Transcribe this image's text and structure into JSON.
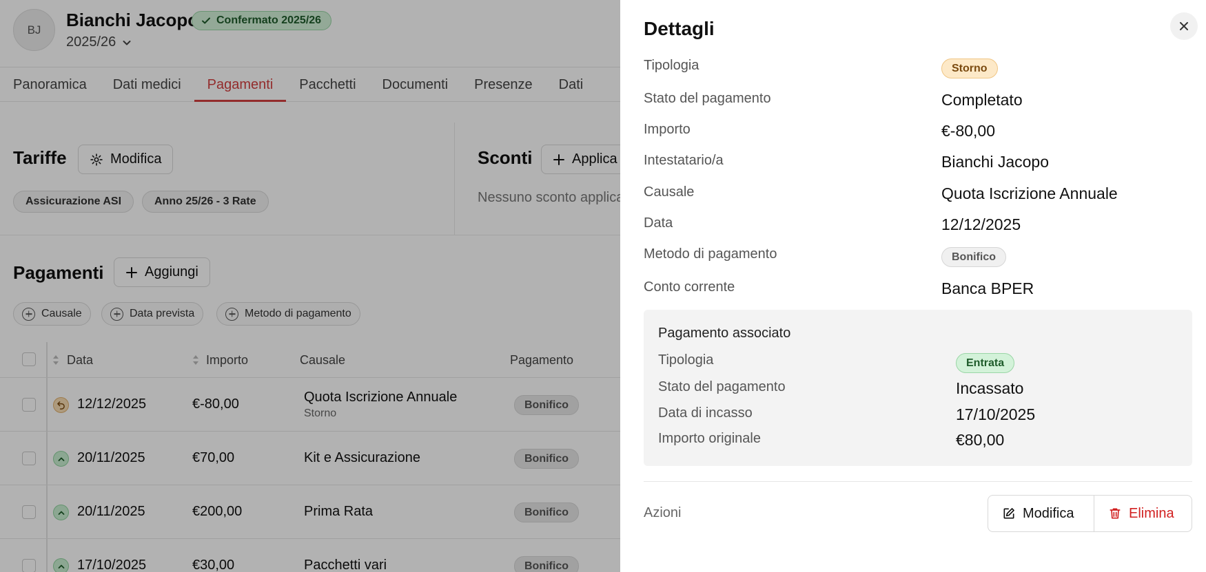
{
  "header": {
    "initials": "BJ",
    "name": "Bianchi Jacopo",
    "badge": "Confermato 2025/26",
    "year": "2025/26"
  },
  "tabs": [
    "Panoramica",
    "Dati medici",
    "Pagamenti",
    "Pacchetti",
    "Documenti",
    "Presenze",
    "Dati"
  ],
  "active_tab": "Pagamenti",
  "tariffe": {
    "title": "Tariffe",
    "edit_label": "Modifica",
    "pills": [
      "Assicurazione ASI",
      "Anno 25/26 - 3 Rate"
    ]
  },
  "sconti": {
    "title": "Sconti",
    "apply_label": "Applica",
    "empty": "Nessuno sconto applica"
  },
  "pagamenti": {
    "title": "Pagamenti",
    "add_label": "Aggiungi",
    "filters": [
      "Causale",
      "Data prevista",
      "Metodo di pagamento"
    ],
    "columns": [
      "Data",
      "Importo",
      "Causale",
      "Pagamento"
    ],
    "rows": [
      {
        "status": "storno",
        "date": "12/12/2025",
        "amount": "€-80,00",
        "causale": "Quota Iscrizione Annuale",
        "sub": "Storno",
        "method": "Bonifico"
      },
      {
        "status": "entrata",
        "date": "20/11/2025",
        "amount": "€70,00",
        "causale": "Kit e Assicurazione",
        "sub": "",
        "method": "Bonifico"
      },
      {
        "status": "entrata",
        "date": "20/11/2025",
        "amount": "€200,00",
        "causale": "Prima Rata",
        "sub": "",
        "method": "Bonifico"
      },
      {
        "status": "entrata",
        "date": "17/10/2025",
        "amount": "€30,00",
        "causale": "Pacchetti vari",
        "sub": "",
        "method": "Bonifico"
      }
    ]
  },
  "panel": {
    "title": "Dettagli",
    "fields": {
      "tipologia_label": "Tipologia",
      "tipologia_value": "Storno",
      "stato_label": "Stato del pagamento",
      "stato_value": "Completato",
      "importo_label": "Importo",
      "importo_value": "€-80,00",
      "intestatario_label": "Intestatario/a",
      "intestatario_value": "Bianchi Jacopo",
      "causale_label": "Causale",
      "causale_value": "Quota Iscrizione Annuale",
      "data_label": "Data",
      "data_value": "12/12/2025",
      "metodo_label": "Metodo di pagamento",
      "metodo_value": "Bonifico",
      "conto_label": "Conto corrente",
      "conto_value": "Banca BPER"
    },
    "associato": {
      "title": "Pagamento associato",
      "tipologia_label": "Tipologia",
      "tipologia_value": "Entrata",
      "stato_label": "Stato del pagamento",
      "stato_value": "Incassato",
      "incasso_label": "Data di incasso",
      "incasso_value": "17/10/2025",
      "originale_label": "Importo originale",
      "originale_value": "€80,00"
    },
    "actions_label": "Azioni",
    "edit_label": "Modifica",
    "delete_label": "Elimina"
  },
  "colors": {
    "accent": "#d33f3f",
    "success_bg": "#d3f2d9",
    "warning_bg": "#fde9c8",
    "danger": "#d11f1f"
  }
}
